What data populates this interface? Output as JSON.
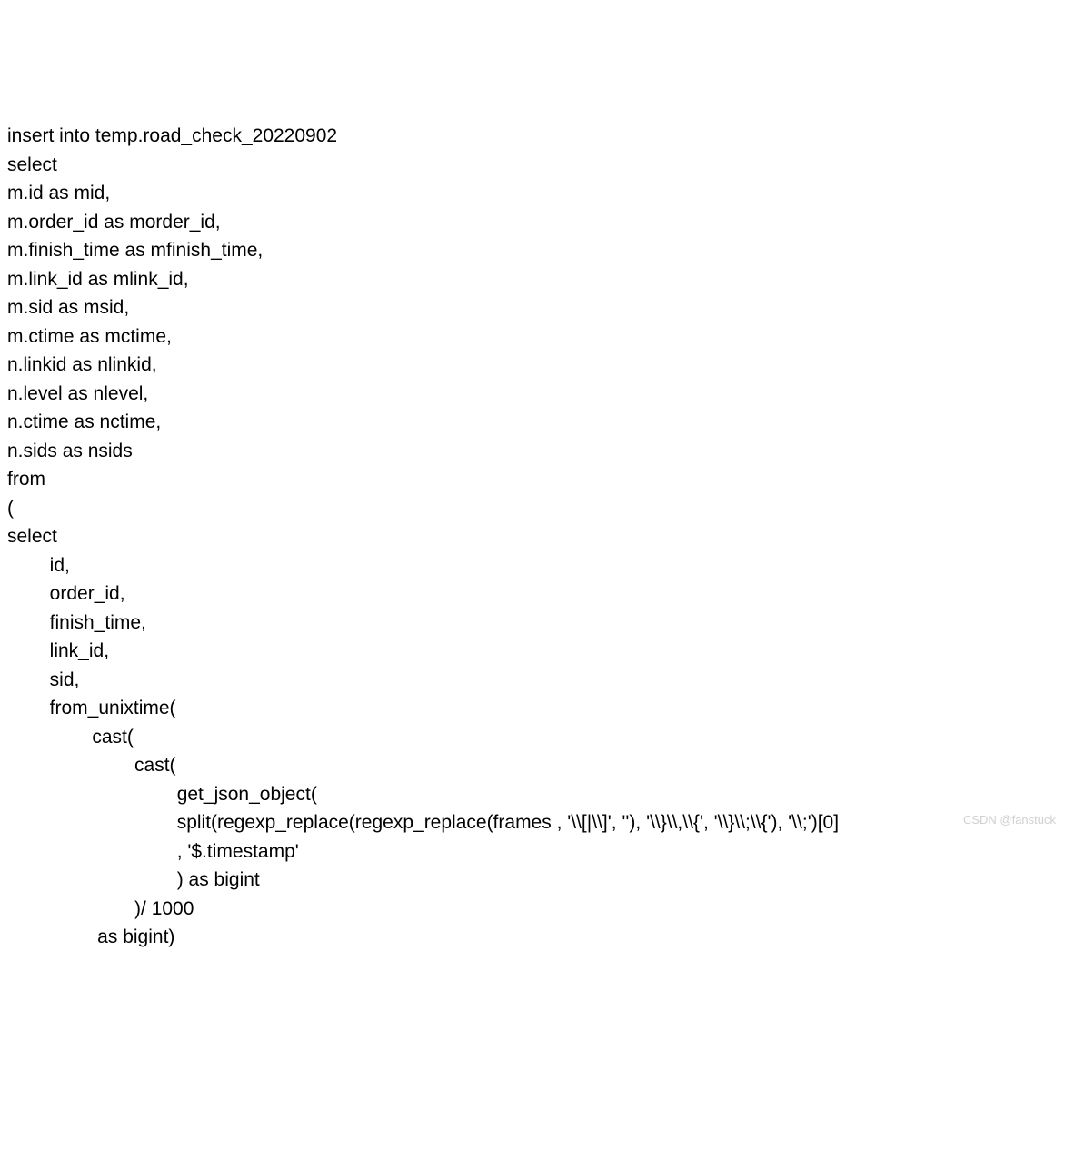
{
  "code": {
    "lines": [
      "insert into temp.road_check_20220902",
      "select",
      "m.id as mid,",
      "m.order_id as morder_id,",
      "m.finish_time as mfinish_time,",
      "m.link_id as mlink_id,",
      "m.sid as msid,",
      "m.ctime as mctime,",
      "n.linkid as nlinkid,",
      "n.level as nlevel,",
      "n.ctime as nctime,",
      "n.sids as nsids",
      "from",
      "(",
      "select",
      "        id,",
      "        order_id,",
      "        finish_time,",
      "        link_id,",
      "        sid,",
      "        from_unixtime(",
      "                cast(",
      "                        cast(",
      "                                get_json_object(",
      "                                split(regexp_replace(regexp_replace(frames , '\\\\[|\\\\]', ''), '\\\\}\\\\,\\\\{', '\\\\}\\\\;\\\\{'), '\\\\;')[0]",
      "                                , '$.timestamp'",
      "                                ) as bigint",
      "                        )/ 1000",
      "                 as bigint)"
    ]
  },
  "watermark": "CSDN @fanstuck"
}
